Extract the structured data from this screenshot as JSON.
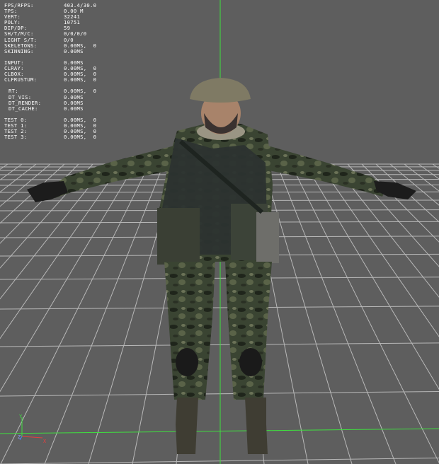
{
  "stats": {
    "group1": [
      {
        "label": "FPS/RFPS:",
        "value": "403.4/30.0"
      },
      {
        "label": "TPS:",
        "value": "0.00 M"
      },
      {
        "label": "VERT:",
        "value": "32241"
      },
      {
        "label": "POLY:",
        "value": "10751"
      },
      {
        "label": "DIP/DP:",
        "value": "59"
      },
      {
        "label": "SH/T/M/C:",
        "value": "0/0/0/0"
      },
      {
        "label": "LIGHT S/T:",
        "value": "0/0"
      },
      {
        "label": "SKELETONS:",
        "value": "0.00MS,  0"
      },
      {
        "label": "SKINNING:",
        "value": "0.00MS"
      }
    ],
    "group2": [
      {
        "label": "INPUT:",
        "value": "0.00MS"
      },
      {
        "label": "CLRAY:",
        "value": "0.00MS,  0"
      },
      {
        "label": "CLBOX:",
        "value": "0.00MS,  0"
      },
      {
        "label": "CLFRUSTUM:",
        "value": "0.00MS,  0"
      }
    ],
    "group3": [
      {
        "label": "RT:",
        "value": "0.00MS,  0"
      },
      {
        "label": "DT_VIS:",
        "value": "0.00MS"
      },
      {
        "label": "DT_RENDER:",
        "value": "0.00MS"
      },
      {
        "label": "DT_CACHE:",
        "value": "0.00MS"
      }
    ],
    "group4": [
      {
        "label": "TEST 0:",
        "value": "0.00MS,  0"
      },
      {
        "label": "TEST 1:",
        "value": "0.00MS,  0"
      },
      {
        "label": "TEST 2:",
        "value": "0.00MS,  0"
      },
      {
        "label": "TEST 3:",
        "value": "0.00MS,  0"
      }
    ]
  },
  "gizmo": {
    "y_label": "Y",
    "z_label": "Z",
    "x_label": "X"
  },
  "colors": {
    "background": "#5e5e5e",
    "grid": "#c8c8c8",
    "axis_green": "#3fe03f",
    "axis_red": "#e04040",
    "axis_blue": "#4080ff",
    "stats_text": "#ffffff"
  }
}
